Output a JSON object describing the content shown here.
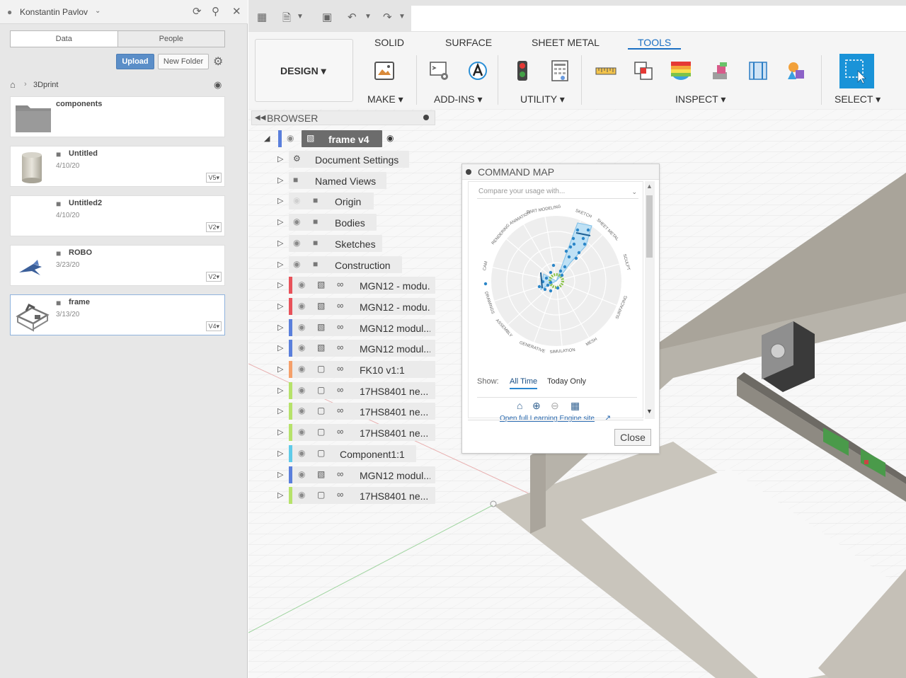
{
  "left_panel": {
    "user_name": "Konstantin Pavlov",
    "tabs": [
      "Data",
      "People"
    ],
    "upload_label": "Upload",
    "new_folder_label": "New Folder",
    "breadcrumb": "3Dprint",
    "folder": {
      "name": "components"
    },
    "files": [
      {
        "name": "Untitled",
        "date": "4/10/20",
        "version": "V5▾"
      },
      {
        "name": "Untitled2",
        "date": "4/10/20",
        "version": "V2▾"
      },
      {
        "name": "ROBO",
        "date": "3/23/20",
        "version": "V2▾"
      },
      {
        "name": "frame",
        "date": "3/13/20",
        "version": "V4▾"
      }
    ]
  },
  "toolbar": {
    "design_label": "DESIGN ▾",
    "tabs": [
      "SOLID",
      "SURFACE",
      "SHEET METAL",
      "TOOLS"
    ],
    "active_tab": "TOOLS",
    "groups": [
      "MAKE ▾",
      "ADD-INS ▾",
      "UTILITY ▾",
      "INSPECT ▾",
      "SELECT ▾"
    ]
  },
  "browser": {
    "title": "BROWSER",
    "root": "frame v4",
    "items": [
      {
        "label": "Document Settings",
        "type": "settings"
      },
      {
        "label": "Named Views",
        "type": "folder"
      },
      {
        "label": "Origin",
        "type": "folder-hidden"
      },
      {
        "label": "Bodies",
        "type": "folder"
      },
      {
        "label": "Sketches",
        "type": "folder"
      },
      {
        "label": "Construction",
        "type": "folder"
      },
      {
        "label": "MGN12 - modu...",
        "type": "comp",
        "color": "#e8525a"
      },
      {
        "label": "MGN12 - modu...",
        "type": "comp",
        "color": "#e8525a"
      },
      {
        "label": "MGN12 modul...",
        "type": "comp",
        "color": "#5a7fdc"
      },
      {
        "label": "MGN12 modul...",
        "type": "comp",
        "color": "#5a7fdc"
      },
      {
        "label": "FK10 v1:1",
        "type": "comp",
        "color": "#f5a06a"
      },
      {
        "label": "17HS8401 ne...",
        "type": "comp",
        "color": "#b6e26a"
      },
      {
        "label": "17HS8401 ne...",
        "type": "comp",
        "color": "#b6e26a"
      },
      {
        "label": "17HS8401 ne...",
        "type": "comp",
        "color": "#b6e26a"
      },
      {
        "label": "Component1:1",
        "type": "comp-nolink",
        "color": "#5fcbe9"
      },
      {
        "label": "MGN12 modul...",
        "type": "comp",
        "color": "#5a7fdc"
      },
      {
        "label": "17HS8401 ne...",
        "type": "comp",
        "color": "#b6e26a"
      }
    ]
  },
  "command_map": {
    "title": "COMMAND MAP",
    "compare_placeholder": "Compare your usage with...",
    "radar_labels": [
      "SKETCH",
      "SHEET METAL",
      "SCULPT",
      "SURFACING",
      "MESH",
      "SIMULATION",
      "GENERATIVE",
      "ASSEMBLY",
      "DRAWINGS",
      "CAM",
      "RENDERING",
      "ANIMATION",
      "PART MODELING"
    ],
    "show_label": "Show:",
    "show_options": [
      "All Time",
      "Today Only"
    ],
    "active_option": "All Time",
    "link_text": "Open full Learning Engine site",
    "close_label": "Close"
  }
}
